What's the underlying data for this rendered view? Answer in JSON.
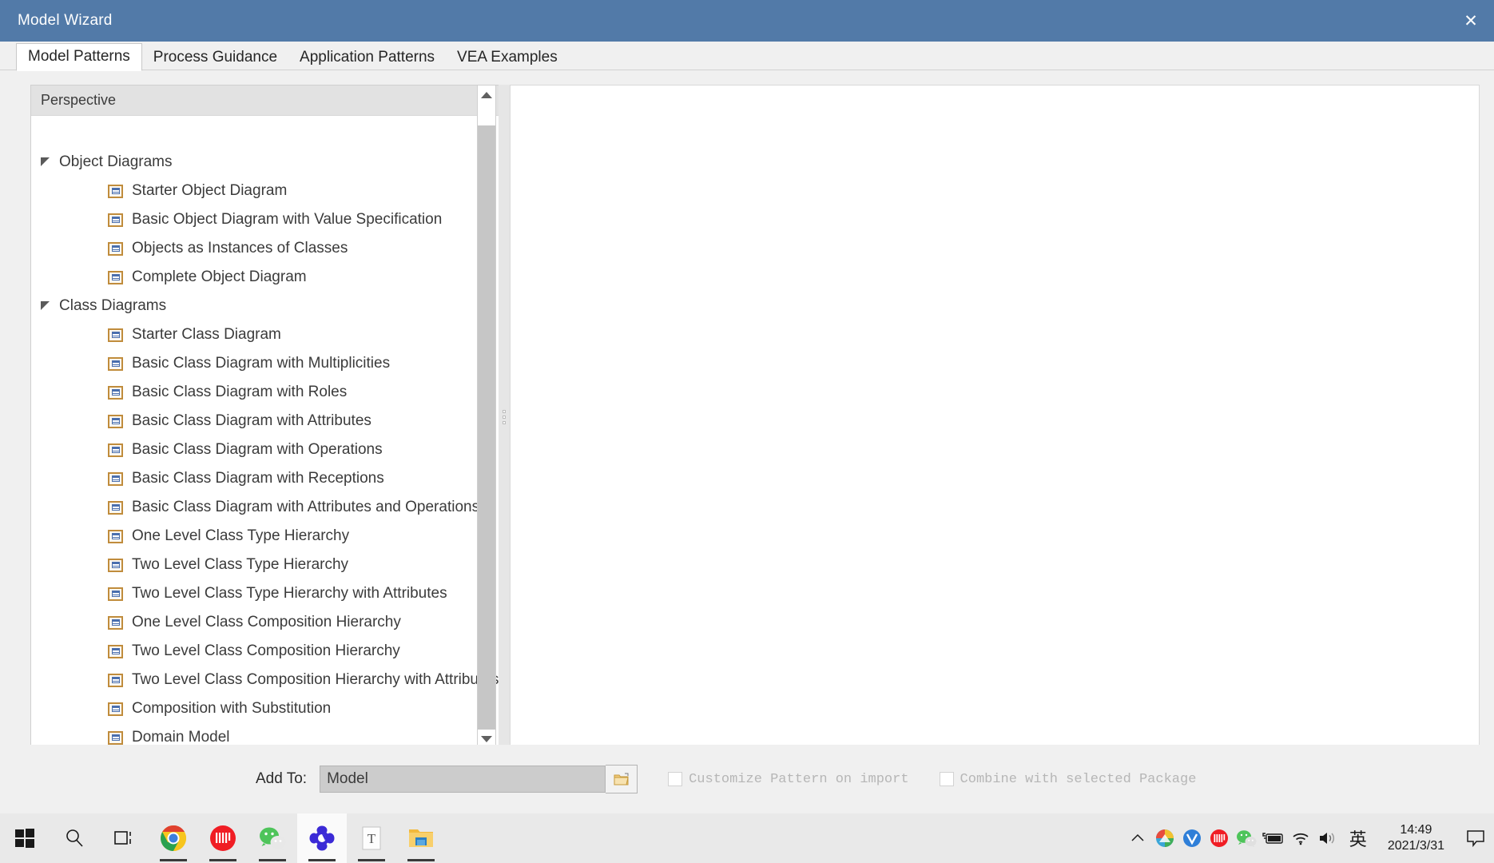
{
  "window": {
    "title": "Model Wizard",
    "close_icon": "close-icon",
    "titlebar_color": "#527aa8"
  },
  "tabs": [
    {
      "label": "Model Patterns",
      "active": true
    },
    {
      "label": "Process Guidance",
      "active": false
    },
    {
      "label": "Application Patterns",
      "active": false
    },
    {
      "label": "VEA Examples",
      "active": false
    }
  ],
  "left_pane": {
    "perspective": {
      "label": "Perspective",
      "caret_icon": "chevron-down-icon"
    },
    "search": {
      "icon": "search-icon",
      "value": "",
      "placeholder": ""
    },
    "groups": [
      {
        "label": "Object Diagrams",
        "expanded": true,
        "items": [
          "Starter Object Diagram",
          "Basic Object Diagram with Value Specification",
          "Objects as Instances of Classes",
          "Complete Object Diagram"
        ]
      },
      {
        "label": "Class Diagrams",
        "expanded": true,
        "items": [
          "Starter Class Diagram",
          "Basic Class Diagram with Multiplicities",
          "Basic Class Diagram with Roles",
          "Basic Class Diagram with Attributes",
          "Basic Class Diagram with Operations",
          "Basic Class Diagram with Receptions",
          "Basic Class Diagram with Attributes and Operations",
          "One Level Class Type Hierarchy",
          "Two Level Class Type Hierarchy",
          "Two Level Class Type Hierarchy with Attributes",
          "One Level Class Composition Hierarchy",
          "Two Level Class Composition Hierarchy",
          "Two Level Class Composition Hierarchy with Attributes",
          "Composition with Substitution",
          "Domain Model"
        ]
      }
    ]
  },
  "scrollbar": {
    "up_icon": "scroll-up-arrow-icon",
    "down_icon": "scroll-down-arrow-icon"
  },
  "right_pane": {
    "content": ""
  },
  "footer": {
    "add_to_label": "Add To:",
    "add_to_value": "Model",
    "browse_icon": "folder-browse-icon",
    "checkboxes": [
      {
        "label": "Customize Pattern on import",
        "checked": false
      },
      {
        "label": "Combine with selected Package",
        "checked": false
      }
    ]
  },
  "taskbar": {
    "items": [
      {
        "name": "start-button",
        "icon": "windows-logo-icon"
      },
      {
        "name": "search-button",
        "icon": "search-icon"
      },
      {
        "name": "task-view-button",
        "icon": "task-view-icon"
      },
      {
        "name": "taskbar-chrome",
        "icon": "chrome-icon"
      },
      {
        "name": "taskbar-iqiyi",
        "icon": "iqiyi-icon"
      },
      {
        "name": "taskbar-wechat",
        "icon": "wechat-icon"
      },
      {
        "name": "taskbar-enterprise-architect",
        "icon": "enterprise-architect-icon"
      },
      {
        "name": "taskbar-text-editor",
        "icon": "text-document-icon"
      },
      {
        "name": "taskbar-file-explorer",
        "icon": "folder-icon"
      }
    ],
    "tray": [
      {
        "name": "tray-show-hidden-icons",
        "icon": "chevron-up-icon"
      },
      {
        "name": "tray-idm",
        "icon": "idm-icon"
      },
      {
        "name": "tray-v-app",
        "icon": "v-circle-icon"
      },
      {
        "name": "tray-iqiyi",
        "icon": "iqiyi-icon"
      },
      {
        "name": "tray-wechat",
        "icon": "wechat-icon"
      },
      {
        "name": "tray-battery",
        "icon": "battery-icon"
      },
      {
        "name": "tray-network",
        "icon": "wifi-icon"
      },
      {
        "name": "tray-volume",
        "icon": "speaker-icon"
      }
    ],
    "ime": "英",
    "clock": {
      "time": "14:49",
      "date": "2021/3/31"
    },
    "action_center_icon": "action-center-icon"
  }
}
